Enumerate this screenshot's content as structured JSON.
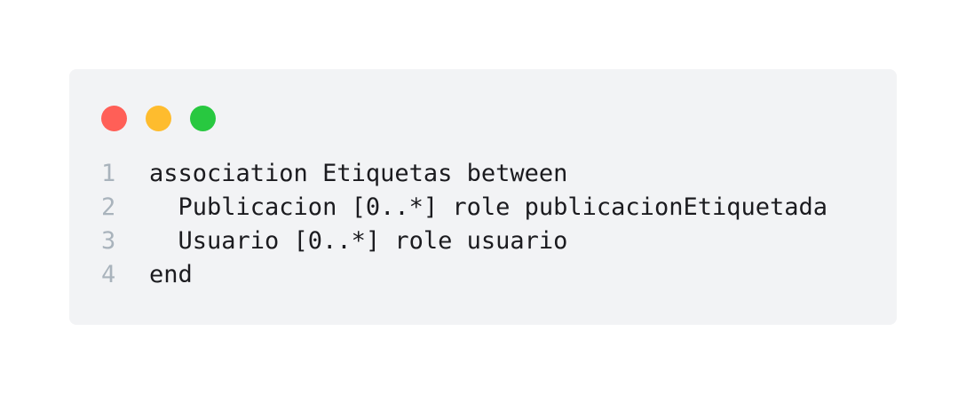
{
  "window": {
    "buttons": [
      {
        "name": "close",
        "color": "#ff5f57"
      },
      {
        "name": "minimize",
        "color": "#febc2e"
      },
      {
        "name": "zoom",
        "color": "#28c840"
      }
    ]
  },
  "code": {
    "lines": [
      {
        "number": "1",
        "text": "association Etiquetas between"
      },
      {
        "number": "2",
        "text": "  Publicacion [0..*] role publicacionEtiquetada"
      },
      {
        "number": "3",
        "text": "  Usuario [0..*] role usuario"
      },
      {
        "number": "4",
        "text": "end"
      }
    ]
  }
}
